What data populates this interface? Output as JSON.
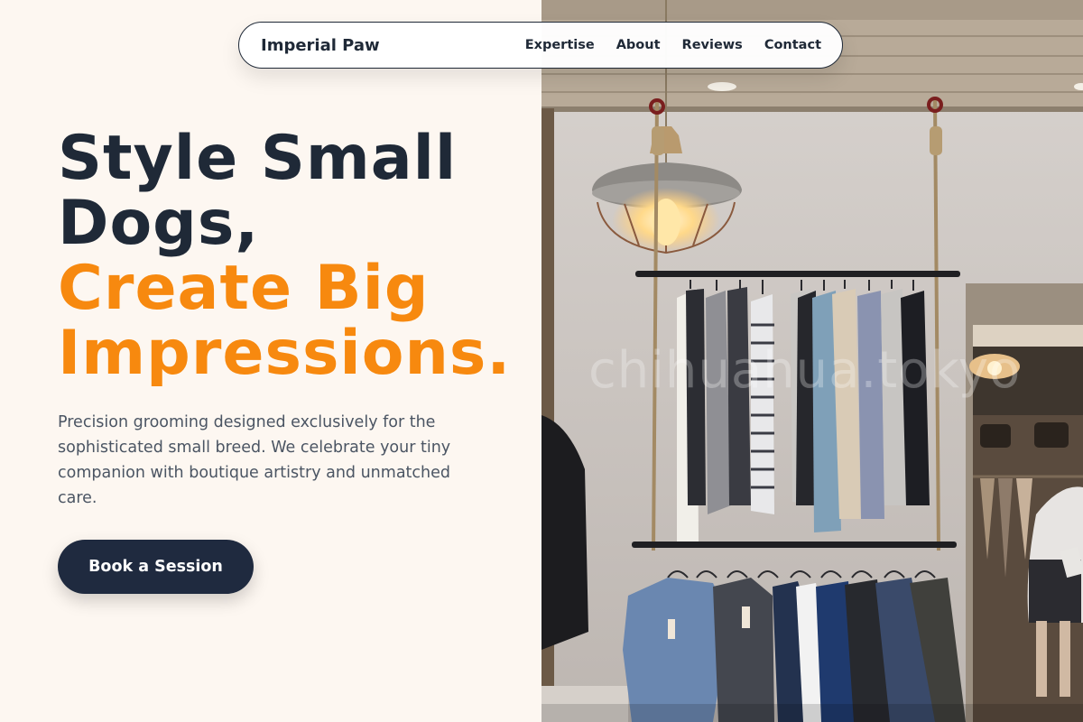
{
  "nav": {
    "brand": "Imperial Paw",
    "links": [
      "Expertise",
      "About",
      "Reviews",
      "Contact"
    ]
  },
  "hero": {
    "title_line1": "Style Small",
    "title_line2": "Dogs,",
    "accent_line1": "Create Big",
    "accent_line2": "Impressions.",
    "description": "Precision grooming designed exclusively for the sophisticated small breed. We celebrate your tiny companion with boutique artistry and unmatched care.",
    "cta_label": "Book a Session"
  },
  "photo": {
    "watermark": "chihuahua.tokyo",
    "subject": "boutique-clothing-rack-photo"
  },
  "colors": {
    "background": "#fdf7f1",
    "ink": "#1f2937",
    "accent": "#f7890f",
    "button": "#1f2a3f"
  }
}
